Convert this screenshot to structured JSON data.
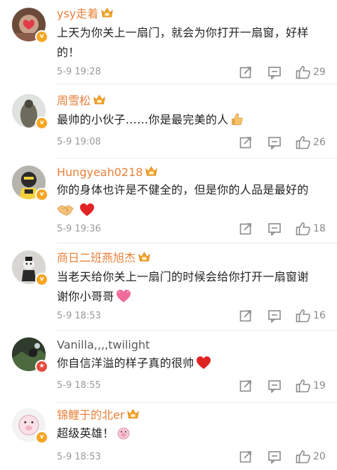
{
  "comments": [
    {
      "username": "ysy走着",
      "text": "上天为你关上一扇门，就会为你打开一扇窗，好样的！",
      "time": "5-9 19:28",
      "likes": "29"
    },
    {
      "username": "周雪松",
      "text": "最帅的小伙子……你是最完美的人",
      "time": "5-9 19:08",
      "likes": "26"
    },
    {
      "username": "Hungyeah0218",
      "text": "你的身体也许是不健全的，但是你的人品是最好的",
      "time": "5-9 19:36",
      "likes": "18"
    },
    {
      "username": "商日二班燕旭杰",
      "text": "当老天给你关上一扇门的时候会给你打开一扇窗谢谢你小哥哥",
      "time": "5-9 18:53",
      "likes": "16"
    },
    {
      "username": "Vanilla,,,,twilight",
      "text": "你自信洋溢的样子真的很帅",
      "time": "5-9 18:55",
      "likes": "19"
    },
    {
      "username": "锦鲤于的北er",
      "text": "超级英雄！",
      "time": "5-9 18:53",
      "likes": "20"
    }
  ],
  "colors": {
    "username": "#e8803a",
    "vip_badge": "#f5a623",
    "red_badge": "#e74c3c",
    "icons": "#8a8a8a"
  },
  "icons": {
    "share": "share-edit-icon",
    "reply": "comment-icon",
    "like": "thumbs-up-icon"
  }
}
